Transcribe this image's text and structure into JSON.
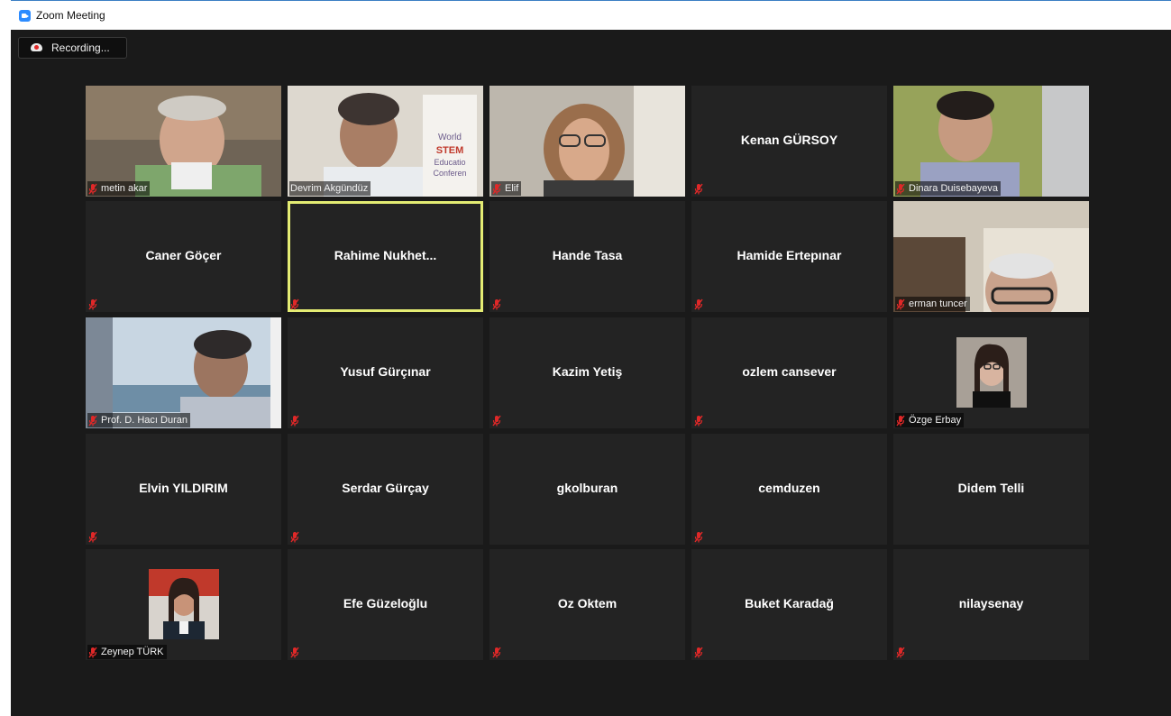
{
  "window": {
    "title": "Zoom Meeting"
  },
  "recording": {
    "label": "Recording..."
  },
  "colors": {
    "accent": "#2d8cff",
    "muted_mic": "#e02828",
    "active_speaker": "#e4ec73"
  },
  "participants": [
    {
      "name": "metin akar",
      "mode": "video",
      "muted": true
    },
    {
      "name": "Devrim Akgündüz",
      "mode": "video",
      "muted": false,
      "poster_text": [
        "Ooo",
        "World",
        "STEM",
        "Educatio",
        "Conferen"
      ]
    },
    {
      "name": "Elif",
      "mode": "video",
      "muted": true
    },
    {
      "name": "Kenan GÜRSOY",
      "mode": "name",
      "muted": true
    },
    {
      "name": "Dinara Duisebayeva",
      "mode": "video",
      "muted": true
    },
    {
      "name": "Caner Göçer",
      "mode": "name",
      "muted": true
    },
    {
      "name": "Rahime  Nukhet...",
      "mode": "name",
      "muted": true,
      "active": true
    },
    {
      "name": "Hande Tasa",
      "mode": "name",
      "muted": true
    },
    {
      "name": "Hamide Ertepınar",
      "mode": "name",
      "muted": true
    },
    {
      "name": "erman tuncer",
      "mode": "video",
      "muted": true
    },
    {
      "name": "Prof. D. Hacı Duran",
      "mode": "video",
      "muted": true
    },
    {
      "name": "Yusuf Gürçınar",
      "mode": "name",
      "muted": true
    },
    {
      "name": "Kazim Yetiş",
      "mode": "name",
      "muted": true
    },
    {
      "name": "ozlem cansever",
      "mode": "name",
      "muted": true
    },
    {
      "name": "Özge Erbay",
      "mode": "avatar",
      "muted": true
    },
    {
      "name": "Elvin YILDIRIM",
      "mode": "name",
      "muted": true
    },
    {
      "name": "Serdar Gürçay",
      "mode": "name",
      "muted": true
    },
    {
      "name": "gkolburan",
      "mode": "name",
      "muted": false
    },
    {
      "name": "cemduzen",
      "mode": "name",
      "muted": true
    },
    {
      "name": "Didem Telli",
      "mode": "name",
      "muted": false
    },
    {
      "name": "Zeynep TÜRK",
      "mode": "avatar",
      "muted": true
    },
    {
      "name": "Efe Güzeloğlu",
      "mode": "name",
      "muted": true
    },
    {
      "name": "Oz Oktem",
      "mode": "name",
      "muted": true
    },
    {
      "name": "Buket Karadağ",
      "mode": "name",
      "muted": true
    },
    {
      "name": "nilaysenay",
      "mode": "name",
      "muted": true
    }
  ]
}
